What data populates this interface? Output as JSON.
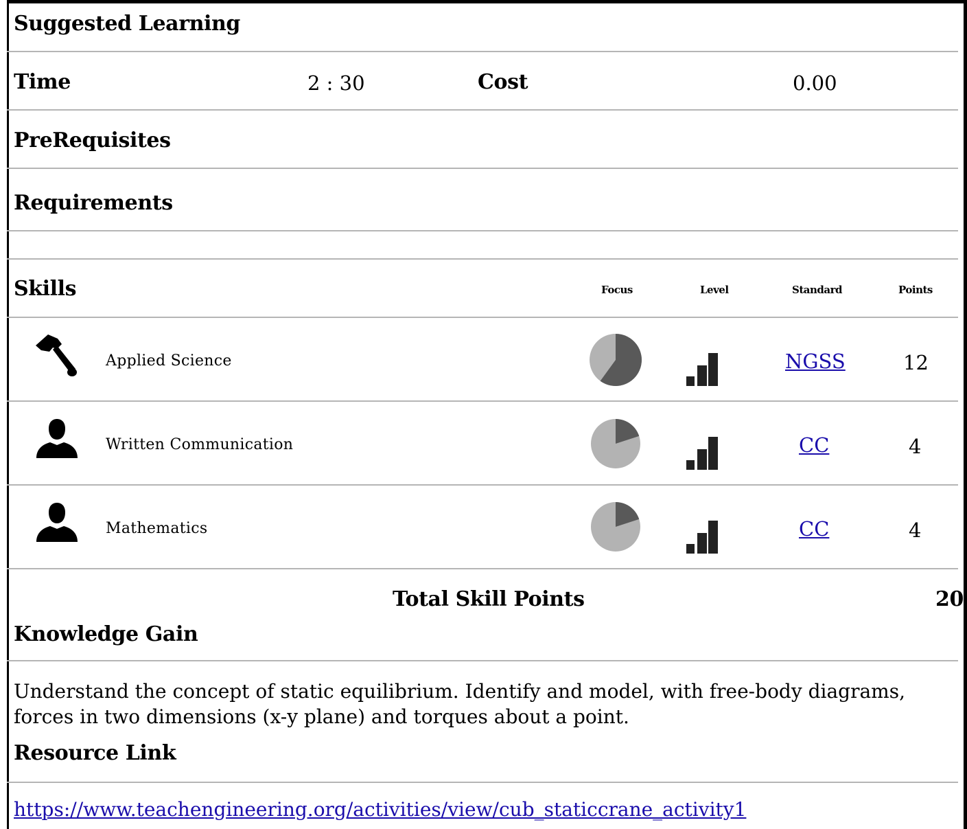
{
  "suggested_learning": {
    "title": "Suggested Learning"
  },
  "time": {
    "label": "Time",
    "value": "2 : 30"
  },
  "cost": {
    "label": "Cost",
    "value": "0.00"
  },
  "prerequisites": {
    "label": "PreRequisites"
  },
  "requirements": {
    "label": "Requirements"
  },
  "skills": {
    "label": "Skills",
    "columns": {
      "focus": "Focus",
      "level": "Level",
      "standard": "Standard",
      "points": "Points"
    },
    "rows": [
      {
        "icon": "hammer-icon",
        "name": "Applied Science",
        "focus_fraction": 0.6,
        "level_bars": 3,
        "standard": "NGSS",
        "points": "12"
      },
      {
        "icon": "person-icon",
        "name": "Written Communication",
        "focus_fraction": 0.2,
        "level_bars": 3,
        "standard": "CC",
        "points": "4"
      },
      {
        "icon": "person-icon",
        "name": "Mathematics",
        "focus_fraction": 0.2,
        "level_bars": 3,
        "standard": "CC",
        "points": "4"
      }
    ],
    "total_label": "Total Skill Points",
    "total_value": "20"
  },
  "knowledge_gain": {
    "label": "Knowledge Gain",
    "lines": [
      "Understand the concept of static equilibrium. Identify and model, with free-body diagrams,",
      "forces in two dimensions (x-y plane) and torques about a point."
    ]
  },
  "resource_link": {
    "label": "Resource Link",
    "url": "https://www.teachengineering.org/activities/view/cub_staticcrane_activity1"
  },
  "colors": {
    "pie_dark": "#595959",
    "pie_light": "#b3b3b3",
    "bars": "#222222",
    "link": "#1a0dab",
    "rule": "#b5b5b5"
  }
}
